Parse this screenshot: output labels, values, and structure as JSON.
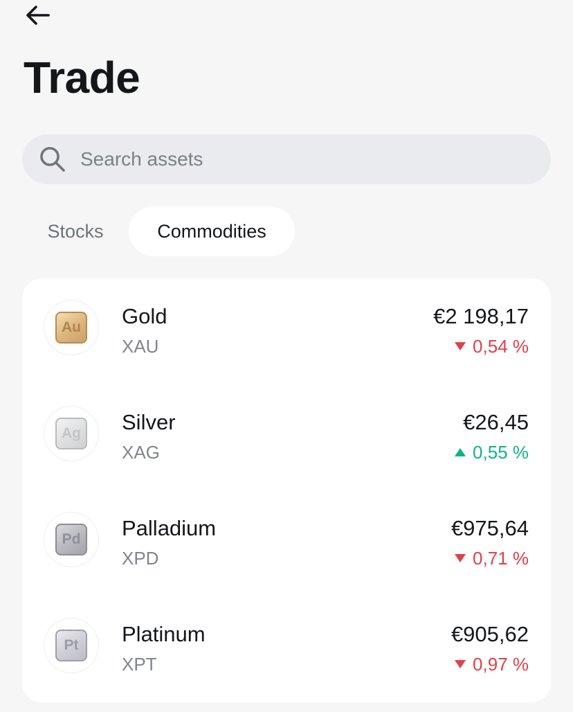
{
  "header": {
    "back_icon": "arrow-left-icon",
    "title": "Trade"
  },
  "search": {
    "icon": "search-icon",
    "placeholder": "Search assets",
    "value": ""
  },
  "tabs": [
    {
      "label": "Stocks",
      "selected": false
    },
    {
      "label": "Commodities",
      "selected": true
    }
  ],
  "assets": [
    {
      "name": "Gold",
      "ticker": "XAU",
      "symbol": "Au",
      "price": "€2 198,17",
      "change": "0,54 %",
      "direction": "down"
    },
    {
      "name": "Silver",
      "ticker": "XAG",
      "symbol": "Ag",
      "price": "€26,45",
      "change": "0,55 %",
      "direction": "up"
    },
    {
      "name": "Palladium",
      "ticker": "XPD",
      "symbol": "Pd",
      "price": "€975,64",
      "change": "0,71 %",
      "direction": "down"
    },
    {
      "name": "Platinum",
      "ticker": "XPT",
      "symbol": "Pt",
      "price": "€905,62",
      "change": "0,97 %",
      "direction": "down"
    }
  ],
  "colors": {
    "background": "#f6f6f7",
    "negative": "#e0404a",
    "positive": "#10b389",
    "gold": "#dcb57d"
  }
}
